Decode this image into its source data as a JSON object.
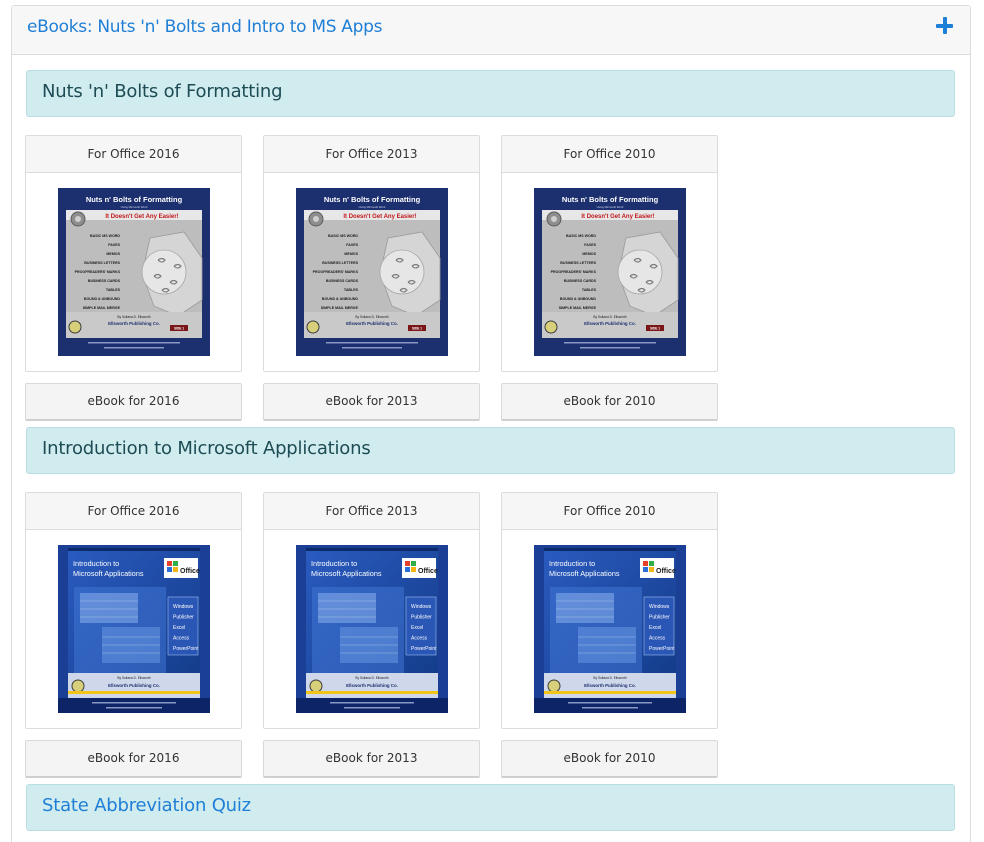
{
  "panel": {
    "title": "eBooks: Nuts 'n' Bolts and Intro to MS Apps",
    "accent_color": "#1f7fd6",
    "expand_icon": "plus-icon"
  },
  "sections": [
    {
      "title": "Nuts 'n' Bolts of Formatting",
      "cards": [
        {
          "header": "For Office 2016",
          "button": "eBook for 2016"
        },
        {
          "header": "For Office 2013",
          "button": "eBook for 2013"
        },
        {
          "header": "For Office 2010",
          "button": "eBook for 2010"
        }
      ],
      "cover": {
        "title": "Nuts n' Bolts of Formatting",
        "subtitle": "Using Microsoft Word",
        "tagline": "It Doesn't Get Any Easier!",
        "topics": [
          "BASIC MS WORD",
          "FAXES",
          "MEMOS",
          "BUSINESS LETTERS",
          "PROOFREADERS' MARKS",
          "BUSINESS CARDS",
          "TABLES",
          "BOUND & UNBOUND",
          "SIMPLE MAIL MERGE"
        ],
        "author": "By Sultana D. Ellsworth",
        "publisher": "Ellsworth Publishing Co.",
        "side": "SIDE 1"
      }
    },
    {
      "title": "Introduction to Microsoft Applications",
      "cards": [
        {
          "header": "For Office 2016",
          "button": "eBook for 2016"
        },
        {
          "header": "For Office 2013",
          "button": "eBook for 2013"
        },
        {
          "header": "For Office 2010",
          "button": "eBook for 2010"
        }
      ],
      "cover": {
        "title_line1": "Introduction to",
        "title_line2": "Microsoft Applications",
        "office_label": "Office",
        "apps": [
          "Windows",
          "Publisher",
          "Excel",
          "Access",
          "PowerPoint"
        ],
        "author": "By Sultana D. Ellsworth",
        "publisher": "Ellsworth Publishing Co."
      }
    },
    {
      "title": "State Abbreviation Quiz"
    }
  ]
}
